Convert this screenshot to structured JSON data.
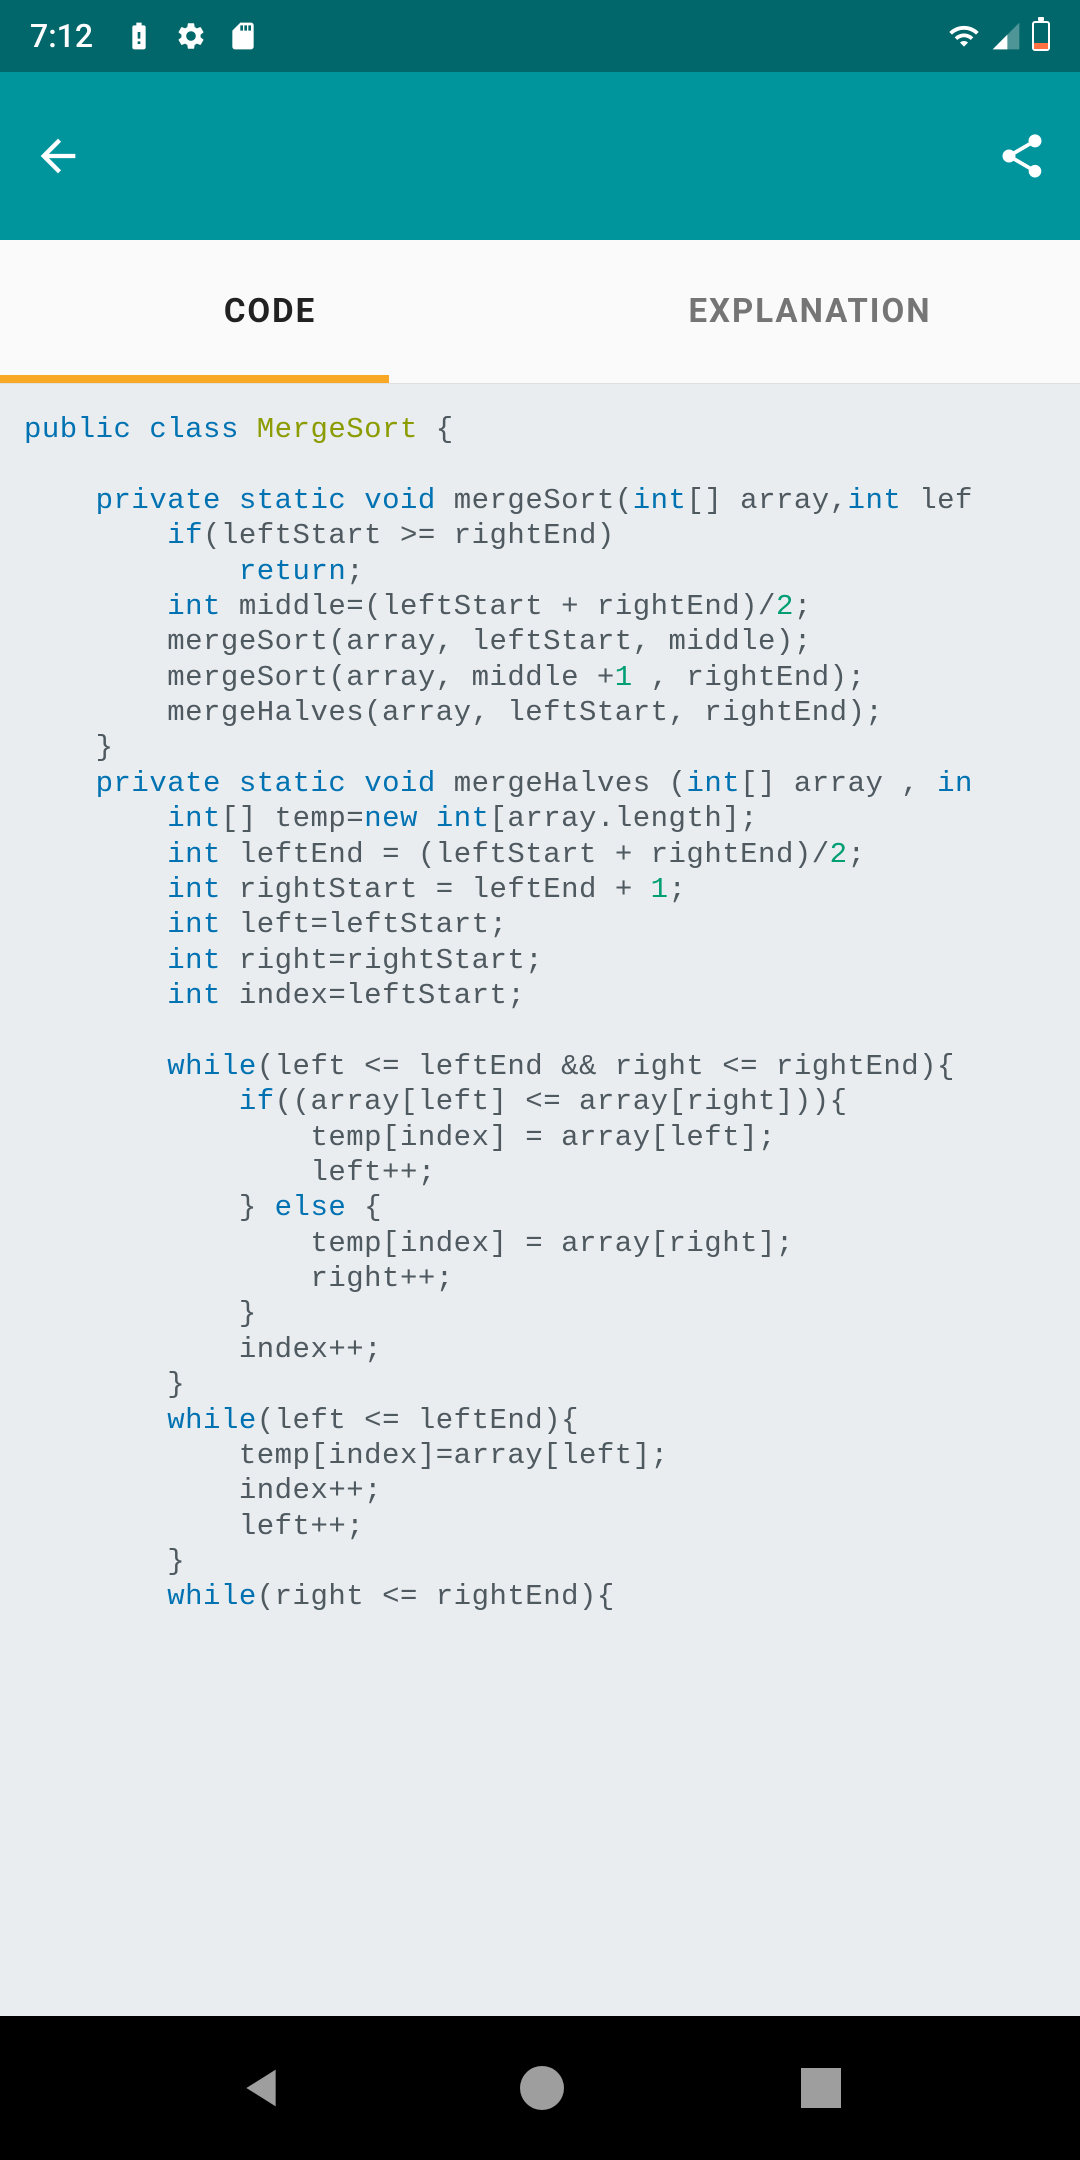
{
  "status": {
    "time": "7:12"
  },
  "tabs": {
    "code": "CODE",
    "explanation": "EXPLANATION"
  },
  "code": {
    "tokens": [
      {
        "t": "public",
        "c": "kw"
      },
      {
        "t": " "
      },
      {
        "t": "class",
        "c": "kw"
      },
      {
        "t": " "
      },
      {
        "t": "MergeSort",
        "c": "cls"
      },
      {
        "t": " {\n"
      },
      {
        "t": "\n"
      },
      {
        "t": "    "
      },
      {
        "t": "private",
        "c": "kw"
      },
      {
        "t": " "
      },
      {
        "t": "static",
        "c": "kw"
      },
      {
        "t": " "
      },
      {
        "t": "void",
        "c": "kw"
      },
      {
        "t": " mergeSort("
      },
      {
        "t": "int",
        "c": "kw"
      },
      {
        "t": "[] array,"
      },
      {
        "t": "int",
        "c": "kw"
      },
      {
        "t": " lef\n"
      },
      {
        "t": "        "
      },
      {
        "t": "if",
        "c": "kw"
      },
      {
        "t": "(leftStart >= rightEnd)\n"
      },
      {
        "t": "            "
      },
      {
        "t": "return",
        "c": "kw"
      },
      {
        "t": ";\n"
      },
      {
        "t": "        "
      },
      {
        "t": "int",
        "c": "kw"
      },
      {
        "t": " middle=(leftStart + rightEnd)/"
      },
      {
        "t": "2",
        "c": "num"
      },
      {
        "t": ";\n"
      },
      {
        "t": "        mergeSort(array, leftStart, middle);\n"
      },
      {
        "t": "        mergeSort(array, middle +"
      },
      {
        "t": "1",
        "c": "num"
      },
      {
        "t": " , rightEnd);\n"
      },
      {
        "t": "        mergeHalves(array, leftStart, rightEnd);\n"
      },
      {
        "t": "    }\n"
      },
      {
        "t": "    "
      },
      {
        "t": "private",
        "c": "kw"
      },
      {
        "t": " "
      },
      {
        "t": "static",
        "c": "kw"
      },
      {
        "t": " "
      },
      {
        "t": "void",
        "c": "kw"
      },
      {
        "t": " mergeHalves ("
      },
      {
        "t": "int",
        "c": "kw"
      },
      {
        "t": "[] array , "
      },
      {
        "t": "in",
        "c": "kw"
      },
      {
        "t": "\n"
      },
      {
        "t": "        "
      },
      {
        "t": "int",
        "c": "kw"
      },
      {
        "t": "[] temp="
      },
      {
        "t": "new",
        "c": "kw"
      },
      {
        "t": " "
      },
      {
        "t": "int",
        "c": "kw"
      },
      {
        "t": "[array.length];\n"
      },
      {
        "t": "        "
      },
      {
        "t": "int",
        "c": "kw"
      },
      {
        "t": " leftEnd = (leftStart + rightEnd)/"
      },
      {
        "t": "2",
        "c": "num"
      },
      {
        "t": ";\n"
      },
      {
        "t": "        "
      },
      {
        "t": "int",
        "c": "kw"
      },
      {
        "t": " rightStart = leftEnd + "
      },
      {
        "t": "1",
        "c": "num"
      },
      {
        "t": ";\n"
      },
      {
        "t": "        "
      },
      {
        "t": "int",
        "c": "kw"
      },
      {
        "t": " left=leftStart;\n"
      },
      {
        "t": "        "
      },
      {
        "t": "int",
        "c": "kw"
      },
      {
        "t": " right=rightStart;\n"
      },
      {
        "t": "        "
      },
      {
        "t": "int",
        "c": "kw"
      },
      {
        "t": " index=leftStart;\n"
      },
      {
        "t": "\n"
      },
      {
        "t": "        "
      },
      {
        "t": "while",
        "c": "kw"
      },
      {
        "t": "(left <= leftEnd && right <= rightEnd){\n"
      },
      {
        "t": "            "
      },
      {
        "t": "if",
        "c": "kw"
      },
      {
        "t": "((array[left] <= array[right])){\n"
      },
      {
        "t": "                temp[index] = array[left];\n"
      },
      {
        "t": "                left++;\n"
      },
      {
        "t": "            } "
      },
      {
        "t": "else",
        "c": "kw"
      },
      {
        "t": " {\n"
      },
      {
        "t": "                temp[index] = array[right];\n"
      },
      {
        "t": "                right++;\n"
      },
      {
        "t": "            }\n"
      },
      {
        "t": "            index++;\n"
      },
      {
        "t": "        }\n"
      },
      {
        "t": "        "
      },
      {
        "t": "while",
        "c": "kw"
      },
      {
        "t": "(left <= leftEnd){\n"
      },
      {
        "t": "            temp[index]=array[left];\n"
      },
      {
        "t": "            index++;\n"
      },
      {
        "t": "            left++;\n"
      },
      {
        "t": "        }\n"
      },
      {
        "t": "        "
      },
      {
        "t": "while",
        "c": "kw"
      },
      {
        "t": "(right <= rightEnd){"
      }
    ]
  }
}
